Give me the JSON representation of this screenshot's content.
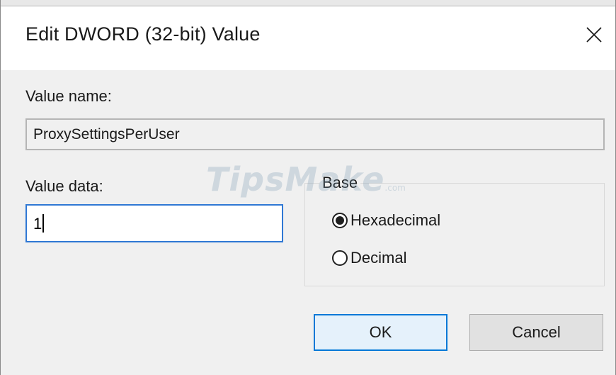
{
  "dialog": {
    "title": "Edit DWORD (32-bit) Value",
    "close_icon": "close-icon"
  },
  "value_name": {
    "label": "Value name:",
    "value": "ProxySettingsPerUser"
  },
  "value_data": {
    "label": "Value data:",
    "value": "1"
  },
  "base": {
    "title": "Base",
    "options": [
      {
        "label": "Hexadecimal",
        "selected": true
      },
      {
        "label": "Decimal",
        "selected": false
      }
    ]
  },
  "buttons": {
    "ok": "OK",
    "cancel": "Cancel"
  },
  "watermark": {
    "text": "TipsMake",
    "suffix": ".com"
  },
  "colors": {
    "accent": "#0078d7",
    "focus_border": "#2f78d4",
    "dialog_bg": "#f0f0f0"
  }
}
